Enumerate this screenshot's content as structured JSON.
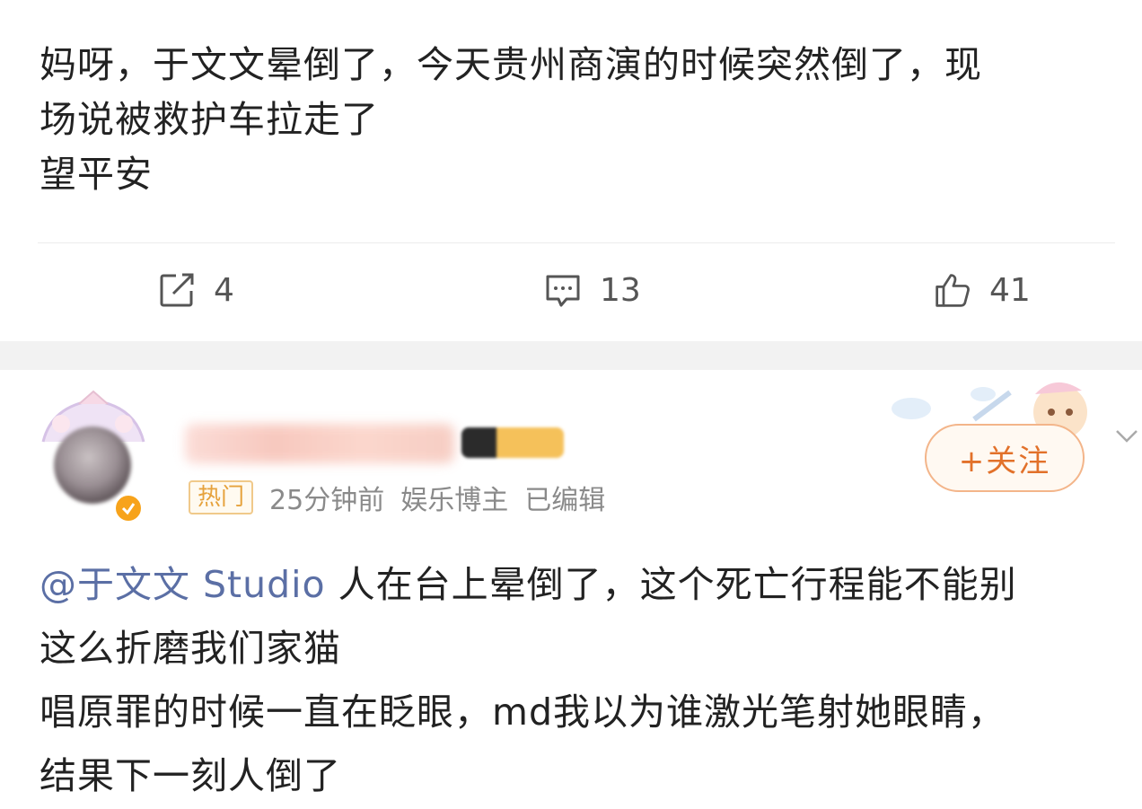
{
  "post": {
    "lines": [
      "妈呀，于文文晕倒了，今天贵州商演的时候突然倒了，现",
      "场说被救护车拉走了",
      "望平安"
    ]
  },
  "actions": {
    "share_count": "4",
    "comment_count": "13",
    "like_count": "41"
  },
  "comment": {
    "hot_tag": "热门",
    "time": "25分钟前",
    "role": "娱乐博主",
    "edited": "已编辑",
    "follow_label": "+关注",
    "mention": "@于文文 Studio",
    "lines": [
      "人在台上晕倒了，这个死亡行程能不能别",
      "这么折磨我们家猫",
      "唱原罪的时候一直在眨眼，md我以为谁激光笔射她眼睛，",
      "结果下一刻人倒了"
    ]
  },
  "colors": {
    "accent_orange": "#e2712a",
    "mention_blue": "#5b6fa5",
    "verified_gold": "#f7a31b"
  }
}
